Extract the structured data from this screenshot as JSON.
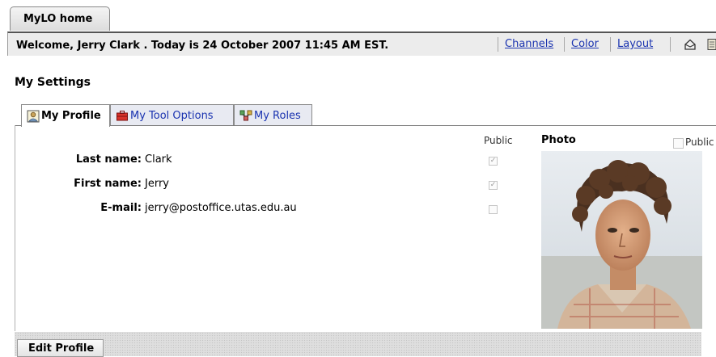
{
  "home_tab": {
    "label": "MyLO home"
  },
  "welcome": {
    "text": "Welcome, Jerry Clark . Today is 24 October 2007 11:45 AM EST."
  },
  "top_links": {
    "channels": "Channels",
    "color": "Color",
    "layout": "Layout"
  },
  "top_icons": [
    "home-icon",
    "notepad-icon"
  ],
  "settings": {
    "title": "My Settings"
  },
  "tabs": [
    {
      "label": "My Profile",
      "icon": "profile-icon",
      "active": true
    },
    {
      "label": "My Tool Options",
      "icon": "toolbox-icon",
      "active": false
    },
    {
      "label": "My Roles",
      "icon": "roles-icon",
      "active": false
    }
  ],
  "profile": {
    "public_header": "Public",
    "fields": [
      {
        "label": "Last name:",
        "value": "Clark",
        "public_checked": true
      },
      {
        "label": "First name:",
        "value": "Jerry",
        "public_checked": true
      },
      {
        "label": "E-mail:",
        "value": "jerry@postoffice.utas.edu.au",
        "public_checked": false
      }
    ],
    "photo_label": "Photo",
    "photo_public_label": "Public",
    "photo_public_checked": false
  },
  "footer": {
    "edit_button": "Edit Profile"
  },
  "colors": {
    "link": "#1a33b0",
    "bar": "#ececec",
    "tab_inactive": "#e8eaf2"
  }
}
